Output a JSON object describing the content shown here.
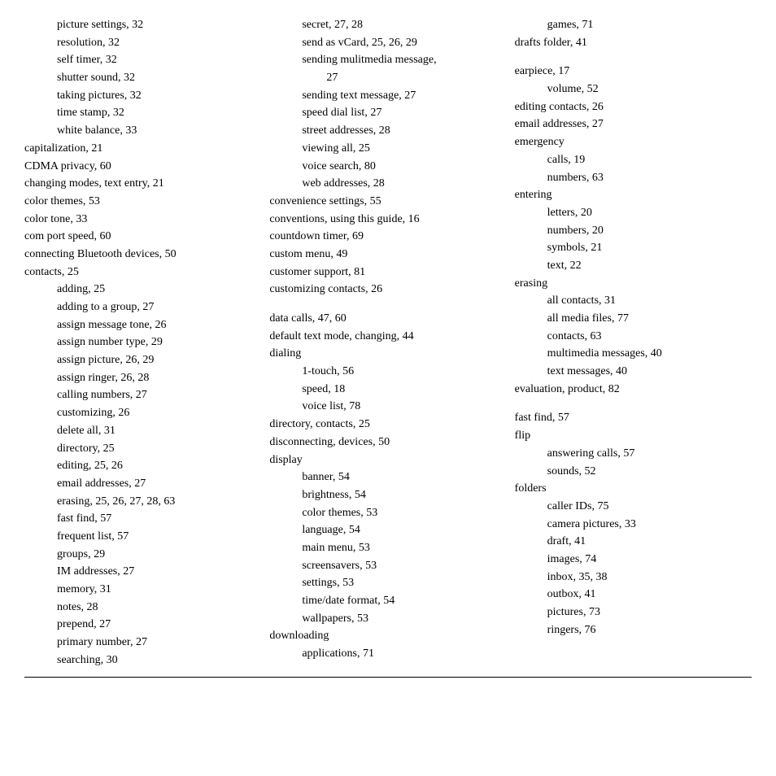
{
  "columns": [
    {
      "id": "col1",
      "entries": [
        {
          "level": "sub",
          "text": "picture settings, 32"
        },
        {
          "level": "sub",
          "text": "resolution, 32"
        },
        {
          "level": "sub",
          "text": "self timer, 32"
        },
        {
          "level": "sub",
          "text": "shutter sound, 32"
        },
        {
          "level": "sub",
          "text": "taking pictures, 32"
        },
        {
          "level": "sub",
          "text": "time stamp, 32"
        },
        {
          "level": "sub",
          "text": "white balance, 33"
        },
        {
          "level": "main",
          "text": "capitalization, 21"
        },
        {
          "level": "main",
          "text": "CDMA privacy, 60"
        },
        {
          "level": "main",
          "text": "changing modes, text entry, 21"
        },
        {
          "level": "main",
          "text": "color themes, 53"
        },
        {
          "level": "main",
          "text": "color tone, 33"
        },
        {
          "level": "main",
          "text": "com port speed, 60"
        },
        {
          "level": "main",
          "text": "connecting Bluetooth devices, 50"
        },
        {
          "level": "main",
          "text": "contacts, 25"
        },
        {
          "level": "sub",
          "text": "adding, 25"
        },
        {
          "level": "sub",
          "text": "adding to a group, 27"
        },
        {
          "level": "sub",
          "text": "assign message tone, 26"
        },
        {
          "level": "sub",
          "text": "assign number type, 29"
        },
        {
          "level": "sub",
          "text": "assign picture, 26, 29"
        },
        {
          "level": "sub",
          "text": "assign ringer, 26, 28"
        },
        {
          "level": "sub",
          "text": "calling numbers, 27"
        },
        {
          "level": "sub",
          "text": "customizing, 26"
        },
        {
          "level": "sub",
          "text": "delete all, 31"
        },
        {
          "level": "sub",
          "text": "directory, 25"
        },
        {
          "level": "sub",
          "text": "editing, 25, 26"
        },
        {
          "level": "sub",
          "text": "email addresses, 27"
        },
        {
          "level": "sub",
          "text": "erasing, 25, 26, 27, 28, 63"
        },
        {
          "level": "sub",
          "text": "fast find, 57"
        },
        {
          "level": "sub",
          "text": "frequent list, 57"
        },
        {
          "level": "sub",
          "text": "groups, 29"
        },
        {
          "level": "sub",
          "text": "IM addresses, 27"
        },
        {
          "level": "sub",
          "text": "memory, 31"
        },
        {
          "level": "sub",
          "text": "notes, 28"
        },
        {
          "level": "sub",
          "text": "prepend, 27"
        },
        {
          "level": "sub",
          "text": "primary number, 27"
        },
        {
          "level": "sub",
          "text": "searching, 30"
        }
      ]
    },
    {
      "id": "col2",
      "entries": [
        {
          "level": "sub",
          "text": "secret, 27, 28"
        },
        {
          "level": "sub",
          "text": "send as vCard, 25, 26, 29"
        },
        {
          "level": "sub",
          "text": "sending mulitmedia message,"
        },
        {
          "level": "sub-sub",
          "text": "27"
        },
        {
          "level": "sub",
          "text": "sending text message, 27"
        },
        {
          "level": "sub",
          "text": "speed dial list, 27"
        },
        {
          "level": "sub",
          "text": "street addresses, 28"
        },
        {
          "level": "sub",
          "text": "viewing all, 25"
        },
        {
          "level": "sub",
          "text": "voice search, 80"
        },
        {
          "level": "sub",
          "text": "web addresses, 28"
        },
        {
          "level": "main",
          "text": "convenience settings, 55"
        },
        {
          "level": "main",
          "text": "conventions, using this guide, 16"
        },
        {
          "level": "main",
          "text": "countdown timer, 69"
        },
        {
          "level": "main",
          "text": "custom menu, 49"
        },
        {
          "level": "main",
          "text": "customer support, 81"
        },
        {
          "level": "main",
          "text": "customizing contacts, 26"
        },
        {
          "level": "spacer",
          "text": ""
        },
        {
          "level": "main",
          "text": "data calls, 47, 60"
        },
        {
          "level": "main",
          "text": "default text mode, changing, 44"
        },
        {
          "level": "main",
          "text": "dialing"
        },
        {
          "level": "sub",
          "text": "1-touch, 56"
        },
        {
          "level": "sub",
          "text": "speed, 18"
        },
        {
          "level": "sub",
          "text": "voice list, 78"
        },
        {
          "level": "main",
          "text": "directory, contacts, 25"
        },
        {
          "level": "main",
          "text": "disconnecting, devices, 50"
        },
        {
          "level": "main",
          "text": "display"
        },
        {
          "level": "sub",
          "text": "banner, 54"
        },
        {
          "level": "sub",
          "text": "brightness, 54"
        },
        {
          "level": "sub",
          "text": "color themes, 53"
        },
        {
          "level": "sub",
          "text": "language, 54"
        },
        {
          "level": "sub",
          "text": "main menu, 53"
        },
        {
          "level": "sub",
          "text": "screensavers, 53"
        },
        {
          "level": "sub",
          "text": "settings, 53"
        },
        {
          "level": "sub",
          "text": "time/date format, 54"
        },
        {
          "level": "sub",
          "text": "wallpapers, 53"
        },
        {
          "level": "main",
          "text": "downloading"
        },
        {
          "level": "sub",
          "text": "applications, 71"
        }
      ]
    },
    {
      "id": "col3",
      "entries": [
        {
          "level": "sub",
          "text": "games, 71"
        },
        {
          "level": "main",
          "text": "drafts folder, 41"
        },
        {
          "level": "spacer",
          "text": ""
        },
        {
          "level": "main",
          "text": "earpiece, 17"
        },
        {
          "level": "sub",
          "text": "volume, 52"
        },
        {
          "level": "main",
          "text": "editing contacts, 26"
        },
        {
          "level": "main",
          "text": "email addresses, 27"
        },
        {
          "level": "main",
          "text": "emergency"
        },
        {
          "level": "sub",
          "text": "calls, 19"
        },
        {
          "level": "sub",
          "text": "numbers, 63"
        },
        {
          "level": "main",
          "text": "entering"
        },
        {
          "level": "sub",
          "text": "letters, 20"
        },
        {
          "level": "sub",
          "text": "numbers, 20"
        },
        {
          "level": "sub",
          "text": "symbols, 21"
        },
        {
          "level": "sub",
          "text": "text, 22"
        },
        {
          "level": "main",
          "text": "erasing"
        },
        {
          "level": "sub",
          "text": "all contacts, 31"
        },
        {
          "level": "sub",
          "text": "all media files, 77"
        },
        {
          "level": "sub",
          "text": "contacts, 63"
        },
        {
          "level": "sub",
          "text": "multimedia messages, 40"
        },
        {
          "level": "sub",
          "text": "text messages, 40"
        },
        {
          "level": "main",
          "text": "evaluation, product, 82"
        },
        {
          "level": "spacer",
          "text": ""
        },
        {
          "level": "main",
          "text": "fast find, 57"
        },
        {
          "level": "main",
          "text": "flip"
        },
        {
          "level": "sub",
          "text": "answering calls, 57"
        },
        {
          "level": "sub",
          "text": "sounds, 52"
        },
        {
          "level": "main",
          "text": "folders"
        },
        {
          "level": "sub",
          "text": "caller IDs, 75"
        },
        {
          "level": "sub",
          "text": "camera pictures, 33"
        },
        {
          "level": "sub",
          "text": "draft, 41"
        },
        {
          "level": "sub",
          "text": "images, 74"
        },
        {
          "level": "sub",
          "text": "inbox, 35, 38"
        },
        {
          "level": "sub",
          "text": "outbox, 41"
        },
        {
          "level": "sub",
          "text": "pictures, 73"
        },
        {
          "level": "sub",
          "text": "ringers, 76"
        }
      ]
    }
  ]
}
